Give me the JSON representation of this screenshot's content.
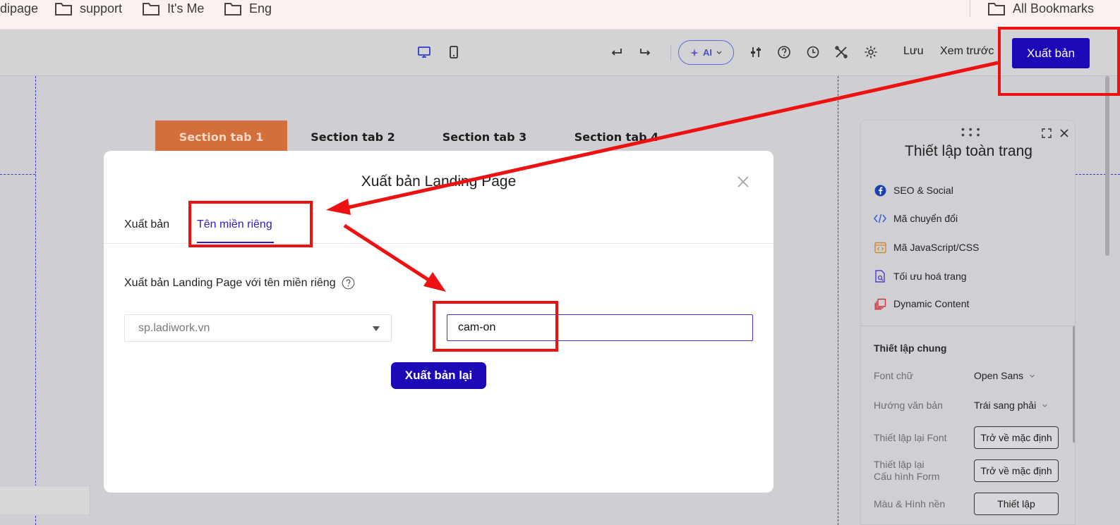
{
  "bookmarks": {
    "items": [
      {
        "label": "dipage"
      },
      {
        "label": "support"
      },
      {
        "label": "It's Me"
      },
      {
        "label": "Eng"
      }
    ],
    "all_label": "All Bookmarks"
  },
  "toolbar": {
    "ai_label": "AI",
    "save_label": "Lưu",
    "preview_label": "Xem trước",
    "publish_label": "Xuất bản"
  },
  "canvas": {
    "section_tabs": [
      "Section tab 1",
      "Section tab 2",
      "Section tab 3",
      "Section tab 4"
    ]
  },
  "panel": {
    "title": "Thiết lập toàn trang",
    "items": [
      {
        "label": "SEO & Social",
        "icon": "facebook-icon",
        "color": "#1e3fa8"
      },
      {
        "label": "Mã chuyển đổi",
        "icon": "code-icon",
        "color": "#2f5fd0"
      },
      {
        "label": "Mã JavaScript/CSS",
        "icon": "code-window-icon",
        "color": "#c98a2d"
      },
      {
        "label": "Tối ưu hoá trang",
        "icon": "page-optimize-icon",
        "color": "#4a3fc9"
      },
      {
        "label": "Dynamic Content",
        "icon": "layers-icon",
        "color": "#c8373a"
      }
    ],
    "section_title": "Thiết lập chung",
    "settings": {
      "font_label": "Font chữ",
      "font_value": "Open Sans",
      "direction_label": "Hướng văn bản",
      "direction_value": "Trái sang phải",
      "reset_font_label": "Thiết lập lại Font",
      "reset_font_button": "Trở về mặc định",
      "reset_form_label_1": "Thiết lập lại",
      "reset_form_label_2": "Cấu hình Form",
      "reset_form_button": "Trở về mặc định",
      "background_label": "Màu & Hình nền",
      "background_button": "Thiết lập"
    }
  },
  "modal": {
    "title": "Xuất bản Landing Page",
    "tabs": [
      {
        "label": "Xuất bản",
        "active": false
      },
      {
        "label": "Tên miền riêng",
        "active": true
      }
    ],
    "field_label": "Xuất bản Landing Page với tên miền riêng",
    "domain_value": "sp.ladiwork.vn",
    "path_value": "cam-on",
    "republish_label": "Xuất bản lại"
  },
  "colors": {
    "accent": "#1d08b8",
    "annotation": "#ee1111",
    "section_tab_active": "#d2703d"
  }
}
